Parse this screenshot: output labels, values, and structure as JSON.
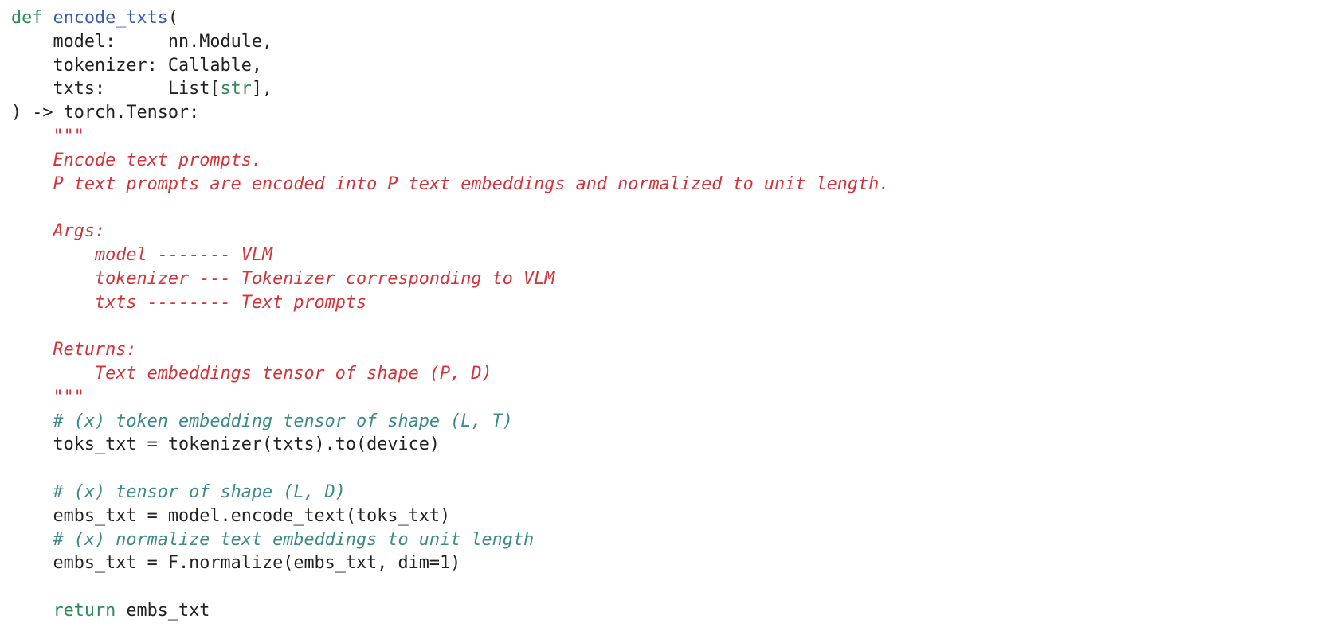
{
  "colors": {
    "keyword": "#2e8b57",
    "function_name": "#3b5cad",
    "builtin": "#2e8b57",
    "text": "#222222",
    "docstring": "#d1343a",
    "comment": "#3d8a8a",
    "background": "#ffffff"
  },
  "code": {
    "lines": [
      [
        {
          "t": "kw",
          "v": "def"
        },
        {
          "t": "plain",
          "v": " "
        },
        {
          "t": "fn",
          "v": "encode_txts"
        },
        {
          "t": "plain",
          "v": "("
        }
      ],
      [
        {
          "t": "plain",
          "v": "    model:     nn.Module,"
        }
      ],
      [
        {
          "t": "plain",
          "v": "    tokenizer: Callable,"
        }
      ],
      [
        {
          "t": "plain",
          "v": "    txts:      List["
        },
        {
          "t": "builtin",
          "v": "str"
        },
        {
          "t": "plain",
          "v": "],"
        }
      ],
      [
        {
          "t": "plain",
          "v": ") -> torch.Tensor:"
        }
      ],
      [
        {
          "t": "doc",
          "v": "    \"\"\""
        }
      ],
      [
        {
          "t": "doc",
          "v": "    Encode text prompts."
        }
      ],
      [
        {
          "t": "doc",
          "v": "    P text prompts are encoded into P text embeddings and normalized to unit length."
        }
      ],
      [],
      [
        {
          "t": "doc",
          "v": "    Args:"
        }
      ],
      [
        {
          "t": "doc",
          "v": "        model ------- VLM"
        }
      ],
      [
        {
          "t": "doc",
          "v": "        tokenizer --- Tokenizer corresponding to VLM"
        }
      ],
      [
        {
          "t": "doc",
          "v": "        txts -------- Text prompts"
        }
      ],
      [],
      [
        {
          "t": "doc",
          "v": "    Returns:"
        }
      ],
      [
        {
          "t": "doc",
          "v": "        Text embeddings tensor of shape (P, D)"
        }
      ],
      [
        {
          "t": "doc",
          "v": "    \"\"\""
        }
      ],
      [
        {
          "t": "comment",
          "v": "    # (x) token embedding tensor of shape (L, T)"
        }
      ],
      [
        {
          "t": "plain",
          "v": "    toks_txt = tokenizer(txts).to(device)"
        }
      ],
      [],
      [
        {
          "t": "comment",
          "v": "    # (x) tensor of shape (L, D)"
        }
      ],
      [
        {
          "t": "plain",
          "v": "    embs_txt = model.encode_text(toks_txt)"
        }
      ],
      [
        {
          "t": "comment",
          "v": "    # (x) normalize text embeddings to unit length"
        }
      ],
      [
        {
          "t": "plain",
          "v": "    embs_txt = F.normalize(embs_txt, dim=1)"
        }
      ],
      [],
      [
        {
          "t": "plain",
          "v": "    "
        },
        {
          "t": "kw",
          "v": "return"
        },
        {
          "t": "plain",
          "v": " embs_txt"
        }
      ]
    ]
  }
}
